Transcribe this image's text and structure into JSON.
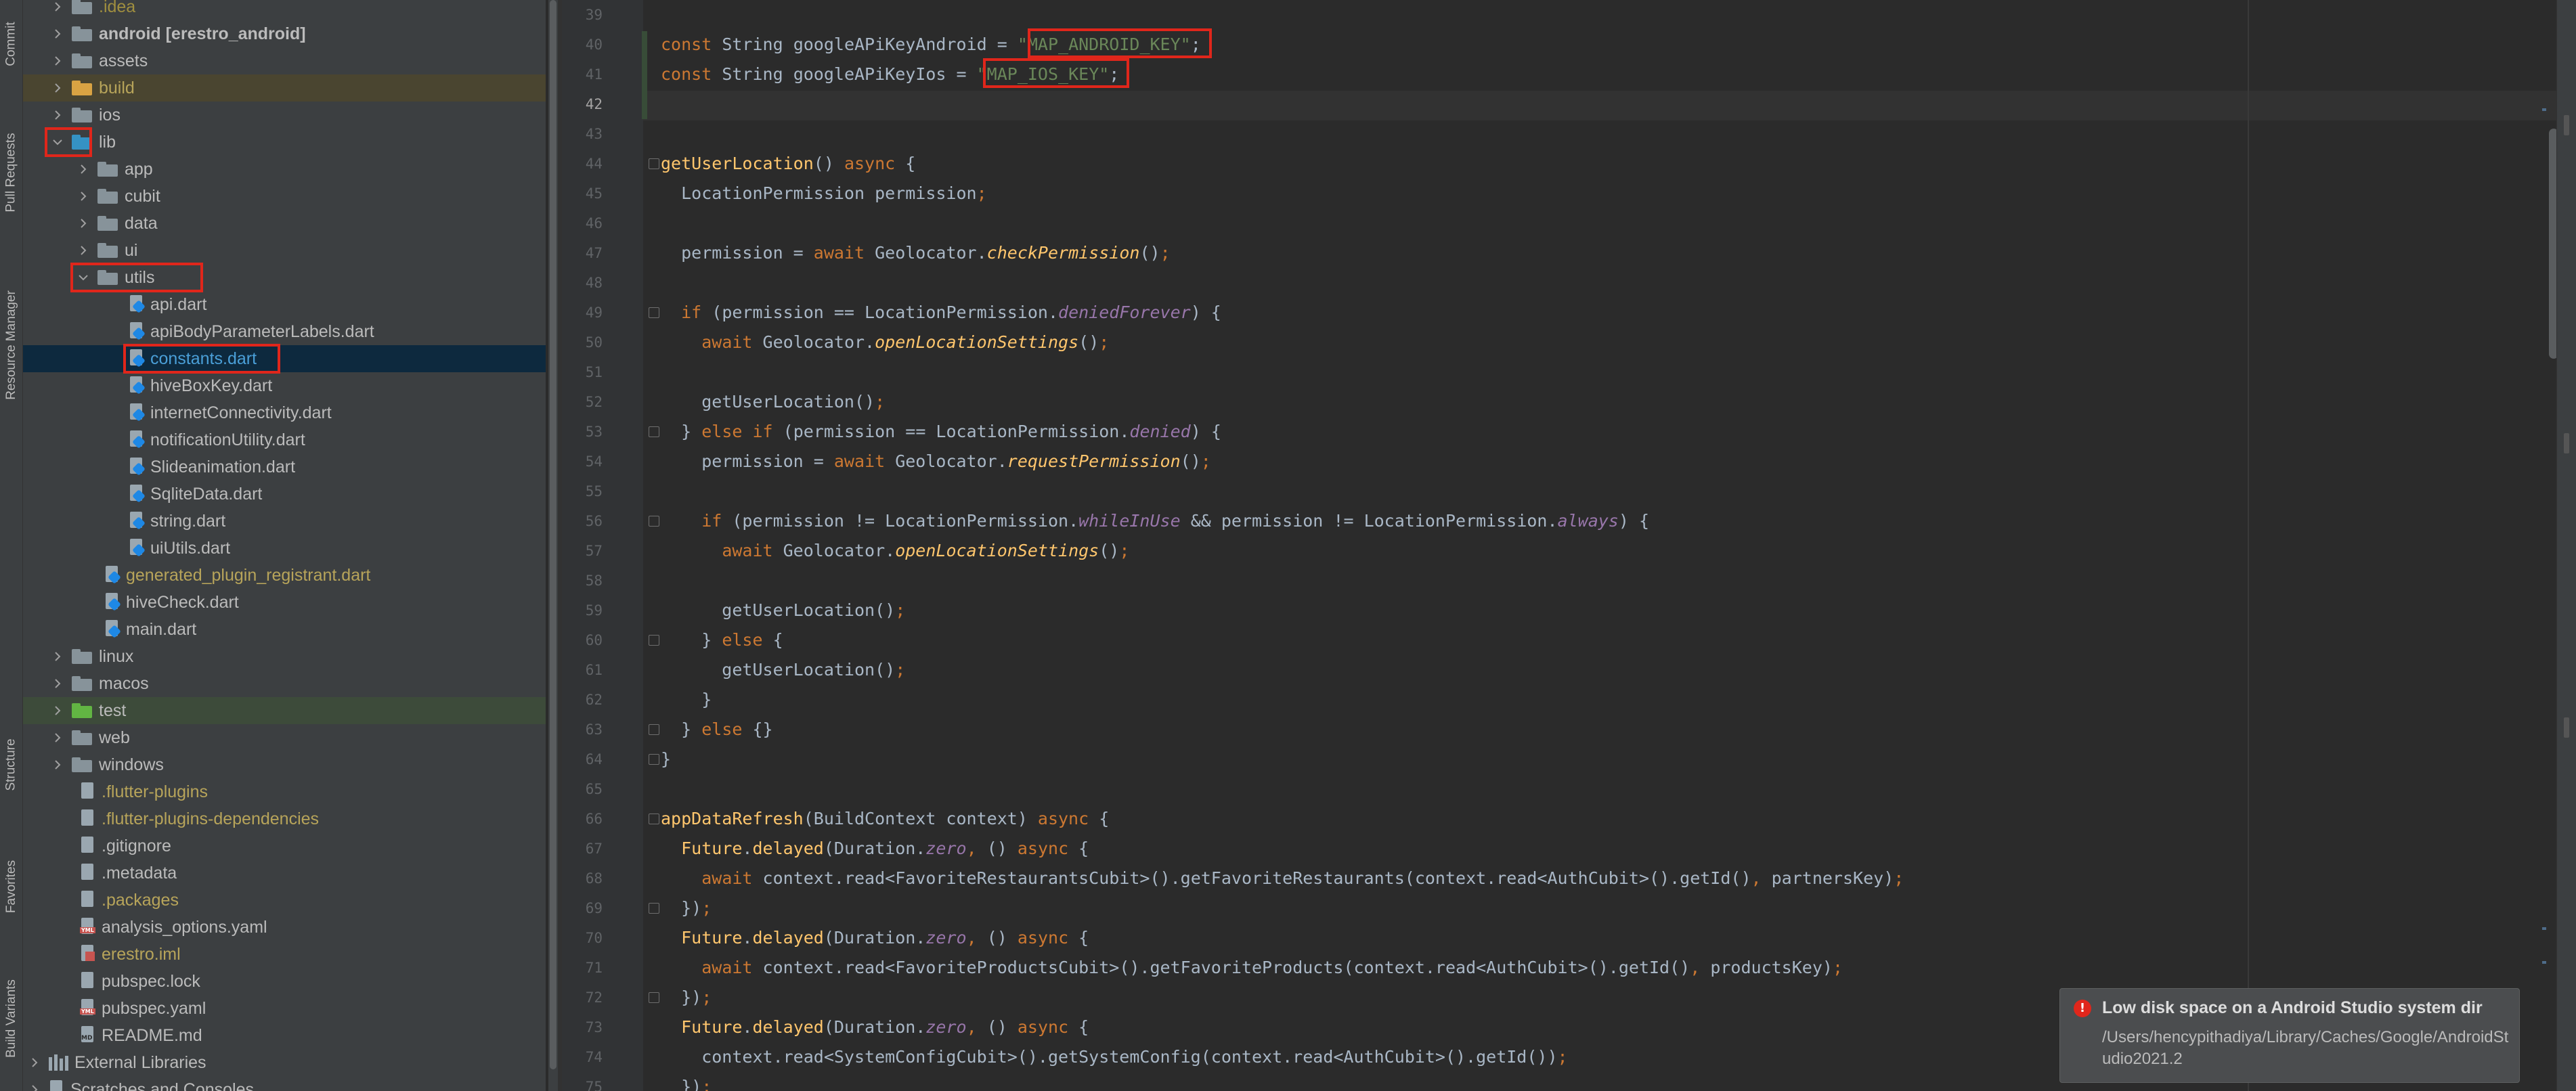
{
  "toolwindow_tabs": {
    "commit": "Commit",
    "pull_requests": "Pull Requests",
    "resource_manager": "Resource Manager",
    "structure": "Structure",
    "favorites": "Favorites",
    "build_variants": "Build Variants"
  },
  "project_tree": {
    "items": [
      {
        "label": ".idea"
      },
      {
        "label": "android [erestro_android]"
      },
      {
        "label": "assets"
      },
      {
        "label": "build"
      },
      {
        "label": "ios"
      },
      {
        "label": "lib"
      },
      {
        "label": "app"
      },
      {
        "label": "cubit"
      },
      {
        "label": "data"
      },
      {
        "label": "ui"
      },
      {
        "label": "utils"
      },
      {
        "label": "api.dart"
      },
      {
        "label": "apiBodyParameterLabels.dart"
      },
      {
        "label": "constants.dart"
      },
      {
        "label": "hiveBoxKey.dart"
      },
      {
        "label": "internetConnectivity.dart"
      },
      {
        "label": "notificationUtility.dart"
      },
      {
        "label": "Slideanimation.dart"
      },
      {
        "label": "SqliteData.dart"
      },
      {
        "label": "string.dart"
      },
      {
        "label": "uiUtils.dart"
      },
      {
        "label": "generated_plugin_registrant.dart"
      },
      {
        "label": "hiveCheck.dart"
      },
      {
        "label": "main.dart"
      },
      {
        "label": "linux"
      },
      {
        "label": "macos"
      },
      {
        "label": "test"
      },
      {
        "label": "web"
      },
      {
        "label": "windows"
      },
      {
        "label": ".flutter-plugins"
      },
      {
        "label": ".flutter-plugins-dependencies"
      },
      {
        "label": ".gitignore"
      },
      {
        "label": ".metadata"
      },
      {
        "label": ".packages"
      },
      {
        "label": "analysis_options.yaml"
      },
      {
        "label": "erestro.iml"
      },
      {
        "label": "pubspec.lock"
      },
      {
        "label": "pubspec.yaml"
      },
      {
        "label": "README.md"
      },
      {
        "label": "External Libraries"
      },
      {
        "label": "Scratches and Consoles"
      }
    ],
    "selected": "constants.dart"
  },
  "editor": {
    "line_numbers": [
      "39",
      "40",
      "41",
      "42",
      "43",
      "44",
      "45",
      "46",
      "47",
      "48",
      "49",
      "50",
      "51",
      "52",
      "53",
      "54",
      "55",
      "56",
      "57",
      "58",
      "59",
      "60",
      "61",
      "62",
      "63",
      "64",
      "65",
      "66",
      "67",
      "68",
      "69",
      "70",
      "71",
      "72",
      "73",
      "74",
      "75"
    ],
    "tokens": {
      "const": "const",
      "string": "String",
      "android_var": "googleAPiKeyAndroid",
      "ios_var": "googleAPiKeyIos",
      "eq": " = ",
      "semi": ";",
      "android_key": "\"MAP_ANDROID_KEY\"",
      "ios_key": "\"MAP_IOS_KEY\"",
      "getUserLocation": "getUserLocation",
      "async": "async",
      "await": "await",
      "if": "if",
      "else": "else",
      "appDataRefresh": "appDataRefresh"
    }
  },
  "notification": {
    "title": "Low disk space on a Android Studio system dir",
    "body": "/Users/hencypithadiya/Library/Caches/Google/AndroidStudio2021.2"
  },
  "colors": {
    "highlight_box": "#e0261b",
    "keyword": "#cc7832",
    "string": "#6a8759",
    "function": "#ffc66d",
    "field": "#9876aa",
    "selected_row": "#0d293e"
  }
}
